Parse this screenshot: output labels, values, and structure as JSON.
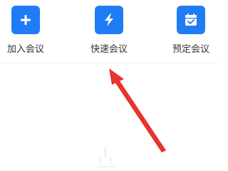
{
  "colors": {
    "tile": "#1f7cf5",
    "arrow": "#e8332e",
    "label": "#333333",
    "divider": "#eeeeee"
  },
  "actions": [
    {
      "icon": "plus-icon",
      "label": "加入会议"
    },
    {
      "icon": "lightning-icon",
      "label": "快速会议"
    },
    {
      "icon": "calendar-check-icon",
      "label": "预定会议"
    }
  ]
}
